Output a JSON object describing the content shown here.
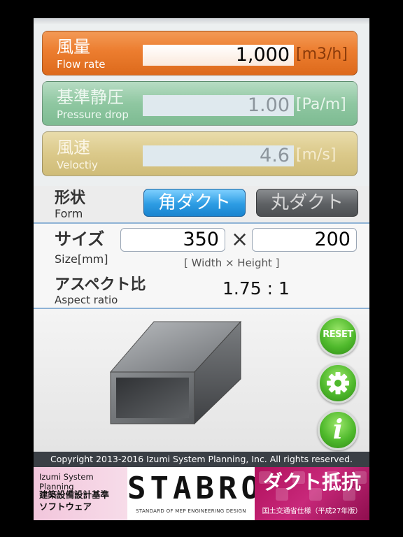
{
  "flow": {
    "label_jp": "風量",
    "label_en": "Flow rate",
    "value": "1,000",
    "unit": "[m3/h]"
  },
  "pressure": {
    "label_jp": "基準静圧",
    "label_en": "Pressure drop",
    "value": "1.00",
    "unit": "[Pa/m]"
  },
  "velocity": {
    "label_jp": "風速",
    "label_en": "Veloctiy",
    "value": "4.6",
    "unit": "[m/s]"
  },
  "form": {
    "label_jp": "形状",
    "label_en": "Form",
    "rect_button": "角ダクト",
    "round_button": "丸ダクト"
  },
  "size": {
    "label_jp": "サイズ",
    "label_en": "Size[mm]",
    "width": "350",
    "times": "×",
    "height": "200",
    "hint": "[ Width  ×  Height ]"
  },
  "aspect": {
    "label_jp": "アスペクト比",
    "label_en": "Aspect ratio",
    "value": "1.75 : 1"
  },
  "buttons": {
    "reset": "RESET",
    "info": "i"
  },
  "copyright": "Copyright 2013-2016 Izumi System Planning, Inc. All rights reserved.",
  "banner": {
    "company": "Izumi System Planning",
    "subtitle_line1": "建築設備設計基準",
    "subtitle_line2": "ソフトウェア",
    "logo": "STABRO",
    "logo_sub": "STANDARD OF MEP ENGINEERING DESIGN",
    "title": "ダクト抵抗",
    "standard": "国土交通省仕様（平成27年版）"
  },
  "colors": {
    "flow": "#ec7d2f",
    "pressure": "#8fc7a1",
    "velocity": "#dbc98a",
    "accent_blue": "#2d9ce3",
    "green_button": "#4fb92c"
  },
  "icons": [
    "gear-icon",
    "info-icon"
  ]
}
